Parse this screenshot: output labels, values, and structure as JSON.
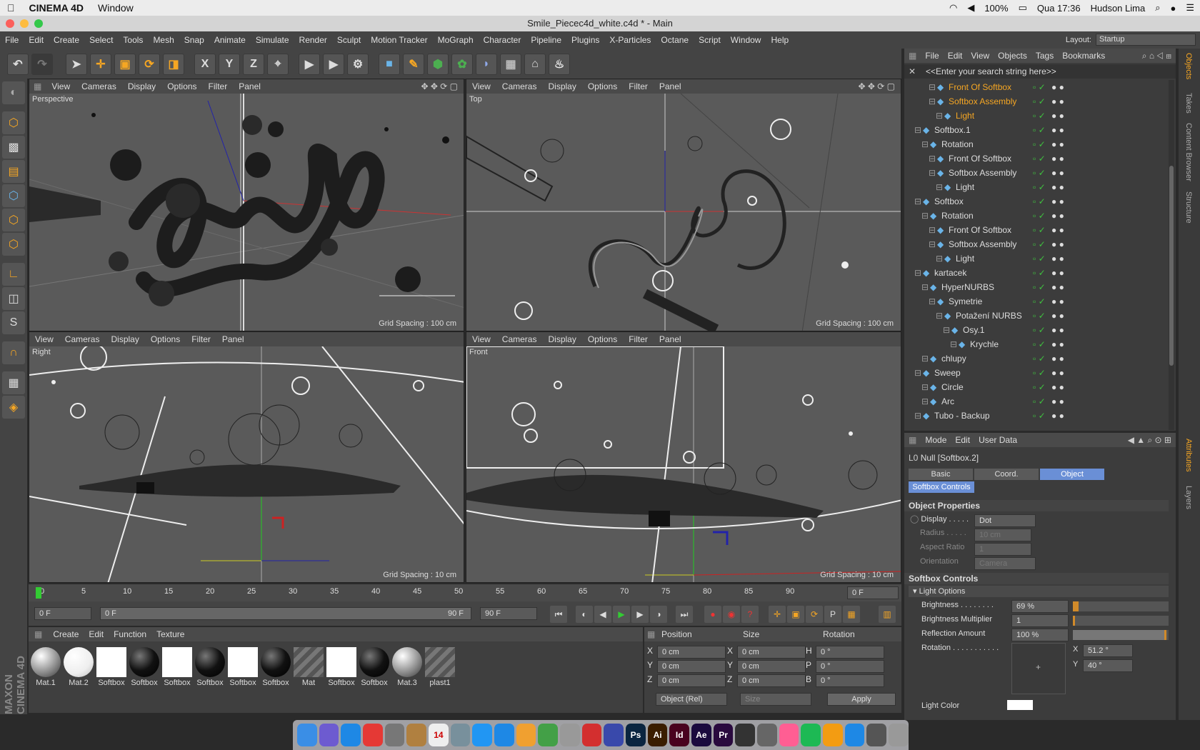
{
  "mac_menu": {
    "apple": "",
    "app": "CINEMA 4D",
    "window": "Window"
  },
  "status": {
    "battery": "100%",
    "clock": "Qua 17:36",
    "user": "Hudson Lima"
  },
  "window_title": "Smile_Piecec4d_white.c4d * - Main",
  "menu": [
    "File",
    "Edit",
    "Create",
    "Select",
    "Tools",
    "Mesh",
    "Snap",
    "Animate",
    "Simulate",
    "Render",
    "Sculpt",
    "Motion Tracker",
    "MoGraph",
    "Character",
    "Pipeline",
    "Plugins",
    "X-Particles",
    "Octane",
    "Script",
    "Window",
    "Help"
  ],
  "layout": {
    "label": "Layout:",
    "value": "Startup"
  },
  "toolbar_xyz": [
    "X",
    "Y",
    "Z"
  ],
  "viewport_menu": [
    "View",
    "Cameras",
    "Display",
    "Options",
    "Filter",
    "Panel"
  ],
  "viewports": [
    {
      "name": "Perspective",
      "grid": "Grid Spacing : 100 cm"
    },
    {
      "name": "Top",
      "grid": "Grid Spacing : 100 cm"
    },
    {
      "name": "Right",
      "grid": "Grid Spacing : 10 cm"
    },
    {
      "name": "Front",
      "grid": "Grid Spacing : 10 cm"
    }
  ],
  "timeline": {
    "ticks": [
      "0",
      "5",
      "10",
      "15",
      "20",
      "25",
      "30",
      "35",
      "40",
      "45",
      "50",
      "55",
      "60",
      "65",
      "70",
      "75",
      "80",
      "85",
      "90"
    ],
    "current": "0 F"
  },
  "transport": {
    "start": "0 F",
    "range_start": "0 F",
    "range_end": "90 F",
    "end": "90 F"
  },
  "material_menu": [
    "Create",
    "Edit",
    "Function",
    "Texture"
  ],
  "materials": [
    {
      "label": "Mat.1",
      "kind": "grey"
    },
    {
      "label": "Mat.2",
      "kind": "white"
    },
    {
      "label": "Softbox",
      "kind": "square"
    },
    {
      "label": "Softbox",
      "kind": "black"
    },
    {
      "label": "Softbox",
      "kind": "square"
    },
    {
      "label": "Softbox",
      "kind": "black"
    },
    {
      "label": "Softbox",
      "kind": "square"
    },
    {
      "label": "Softbox",
      "kind": "black"
    },
    {
      "label": "Mat",
      "kind": "stripe"
    },
    {
      "label": "Softbox",
      "kind": "square"
    },
    {
      "label": "Softbox",
      "kind": "black"
    },
    {
      "label": "Mat.3",
      "kind": "grey"
    },
    {
      "label": "plast1",
      "kind": "stripe"
    }
  ],
  "coords": {
    "headers": [
      "Position",
      "Size",
      "Rotation"
    ],
    "rows": [
      {
        "a": "X",
        "av": "0 cm",
        "b": "X",
        "bv": "0 cm",
        "c": "H",
        "cv": "0 °"
      },
      {
        "a": "Y",
        "av": "0 cm",
        "b": "Y",
        "bv": "0 cm",
        "c": "P",
        "cv": "0 °"
      },
      {
        "a": "Z",
        "av": "0 cm",
        "b": "Z",
        "bv": "0 cm",
        "c": "B",
        "cv": "0 °"
      }
    ],
    "mode": "Object (Rel)",
    "size_mode": "Size",
    "apply": "Apply"
  },
  "objects_menu": [
    "File",
    "Edit",
    "View",
    "Objects",
    "Tags",
    "Bookmarks"
  ],
  "objects_search": "<<Enter your search string here>>",
  "objects": [
    {
      "label": "Front Of Softbox",
      "indent": 3,
      "hl": true
    },
    {
      "label": "Softbox Assembly",
      "indent": 3,
      "hl": true
    },
    {
      "label": "Light",
      "indent": 4,
      "hl": true
    },
    {
      "label": "Softbox.1",
      "indent": 1,
      "hl": false
    },
    {
      "label": "Rotation",
      "indent": 2,
      "hl": false
    },
    {
      "label": "Front Of Softbox",
      "indent": 3,
      "hl": false
    },
    {
      "label": "Softbox Assembly",
      "indent": 3,
      "hl": false
    },
    {
      "label": "Light",
      "indent": 4,
      "hl": false
    },
    {
      "label": "Softbox",
      "indent": 1,
      "hl": false
    },
    {
      "label": "Rotation",
      "indent": 2,
      "hl": false
    },
    {
      "label": "Front Of Softbox",
      "indent": 3,
      "hl": false
    },
    {
      "label": "Softbox Assembly",
      "indent": 3,
      "hl": false
    },
    {
      "label": "Light",
      "indent": 4,
      "hl": false
    },
    {
      "label": "kartacek",
      "indent": 1,
      "hl": false
    },
    {
      "label": "HyperNURBS",
      "indent": 2,
      "hl": false
    },
    {
      "label": "Symetrie",
      "indent": 3,
      "hl": false
    },
    {
      "label": "Potažení NURBS",
      "indent": 4,
      "hl": false
    },
    {
      "label": "Osy.1",
      "indent": 5,
      "hl": false
    },
    {
      "label": "Krychle",
      "indent": 6,
      "hl": false
    },
    {
      "label": "chlupy",
      "indent": 2,
      "hl": false
    },
    {
      "label": "Sweep",
      "indent": 1,
      "hl": false
    },
    {
      "label": "Circle",
      "indent": 2,
      "hl": false
    },
    {
      "label": "Arc",
      "indent": 2,
      "hl": false
    },
    {
      "label": "Tubo - Backup",
      "indent": 1,
      "hl": false
    }
  ],
  "attr_menu": [
    "Mode",
    "Edit",
    "User Data"
  ],
  "attr_title": "Null [Softbox.2]",
  "attr_tabs": [
    "Basic",
    "Coord.",
    "Object"
  ],
  "attr_subtab": "Softbox Controls",
  "obj_props": {
    "heading": "Object Properties",
    "display_label": "Display . . . . .",
    "display_value": "Dot",
    "radius_label": "Radius . . . . .",
    "radius_value": "10 cm",
    "aspect_label": "Aspect Ratio",
    "aspect_value": "1",
    "orient_label": "Orientation",
    "orient_value": "Camera"
  },
  "softbox": {
    "heading": "Softbox Controls",
    "light_options": "Light Options",
    "brightness_label": "Brightness . . . . . . . .",
    "brightness": "69 %",
    "brightness_level": 0.06,
    "mult_label": "Brightness Multiplier",
    "mult": "1",
    "refl_label": "Reflection Amount",
    "refl": "100 %",
    "refl_level": 1.0,
    "rot_label": "Rotation . . . . . . . . . . .",
    "rot_x_label": "X",
    "rot_x": "51.2 °",
    "rot_y_label": "Y",
    "rot_y": "40 °",
    "color_label": "Light Color"
  },
  "right_tabs": [
    "Objects",
    "Takes",
    "Content Browser",
    "Structure"
  ],
  "right_tabs2": [
    "Attributes",
    "Layers"
  ],
  "maxon_logo": "MAXON CINEMA 4D",
  "dock": [
    {
      "t": "",
      "c": "#3a8ee6"
    },
    {
      "t": "",
      "c": "#6d5bd0"
    },
    {
      "t": "",
      "c": "#1e88e5"
    },
    {
      "t": "",
      "c": "#e53935"
    },
    {
      "t": "",
      "c": "#777"
    },
    {
      "t": "",
      "c": "#b08040"
    },
    {
      "t": "14",
      "c": "#eee"
    },
    {
      "t": "",
      "c": "#78909c"
    },
    {
      "t": "",
      "c": "#2196f3"
    },
    {
      "t": "",
      "c": "#1e88e5"
    },
    {
      "t": "",
      "c": "#f0a030"
    },
    {
      "t": "",
      "c": "#43a047"
    },
    {
      "t": "",
      "c": "#999"
    },
    {
      "t": "",
      "c": "#d32f2f"
    },
    {
      "t": "",
      "c": "#3949ab"
    },
    {
      "t": "Ps",
      "c": "#0a2540"
    },
    {
      "t": "Ai",
      "c": "#3a1d00"
    },
    {
      "t": "Id",
      "c": "#49021f"
    },
    {
      "t": "Ae",
      "c": "#1a0a3e"
    },
    {
      "t": "Pr",
      "c": "#2a0a3e"
    },
    {
      "t": "",
      "c": "#333"
    },
    {
      "t": "",
      "c": "#666"
    },
    {
      "t": "",
      "c": "#ff5e93"
    },
    {
      "t": "",
      "c": "#1db954"
    },
    {
      "t": "",
      "c": "#f39c12"
    },
    {
      "t": "",
      "c": "#1e88e5"
    },
    {
      "t": "",
      "c": "#555"
    },
    {
      "t": "",
      "c": "#999"
    }
  ]
}
